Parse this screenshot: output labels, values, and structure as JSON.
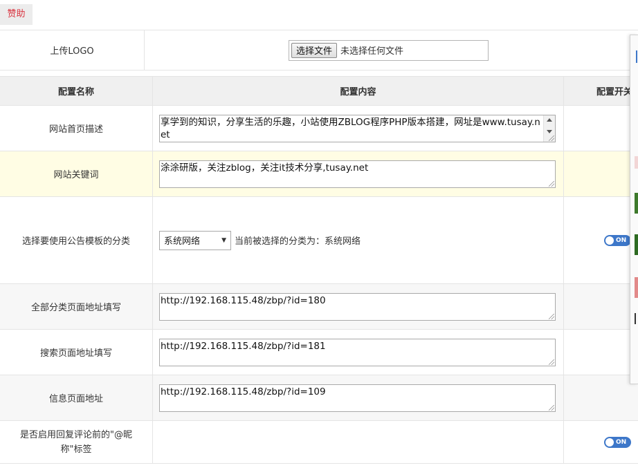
{
  "sponsor_label": "赞助",
  "logo_row": {
    "label": "上传LOGO",
    "file_button": "选择文件",
    "file_status": "未选择任何文件"
  },
  "table_header": {
    "name_col": "配置名称",
    "content_col": "配置内容",
    "switch_col": "配置开关"
  },
  "rows": {
    "homepage_desc": {
      "label": "网站首页描述",
      "value": "享学到的知识，分享生活的乐趣，小站使用ZBLOG程序PHP版本搭建，网址是www.tusay.net"
    },
    "keywords": {
      "label": "网站关键词",
      "value": "涂涂研版，关注zblog，关注it技术分享,tusay.net"
    },
    "category": {
      "label": "选择要使用公告模板的分类",
      "selected": "系统网络",
      "note": "当前被选择的分类为：系统网络",
      "switch": "ON"
    },
    "all_categories_url": {
      "label": "全部分类页面地址填写",
      "value": "http://192.168.115.48/zbp/?id=180"
    },
    "search_url": {
      "label": "搜索页面地址填写",
      "value": "http://192.168.115.48/zbp/?id=181"
    },
    "info_url": {
      "label": "信息页面地址",
      "value": "http://192.168.115.48/zbp/?id=109"
    },
    "reply_tag": {
      "label": "是否启用回复评论前的\"@昵称\"标签",
      "switch": "ON"
    }
  },
  "colors": {
    "toggle_on": "#3d77c9",
    "sponsor_text": "#d9333f",
    "highlight_row": "#fffde4"
  }
}
